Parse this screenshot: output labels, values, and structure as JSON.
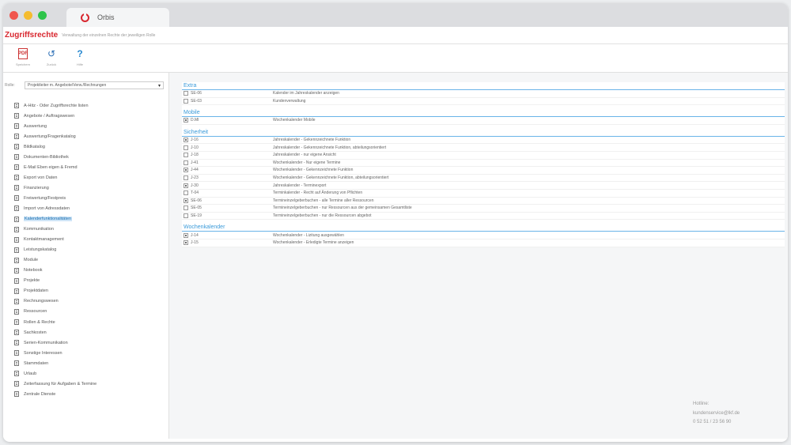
{
  "window": {
    "tab_title": "Orbis"
  },
  "header": {
    "title": "Zugriffsrechte",
    "subtitle": "Verwaltung der einzelnen Rechte der jeweiligen Rolle"
  },
  "toolbar": {
    "items": [
      {
        "label": "Speichern",
        "icon": "pdf-icon"
      },
      {
        "label": "Zurück",
        "icon": "reset-icon"
      },
      {
        "label": "Hilfe",
        "icon": "help-icon"
      }
    ]
  },
  "sidebar": {
    "select_label": "Rolle:",
    "select_value": "Projektleiter m. Angebote/Verw./Rechnungen",
    "items": [
      {
        "label": "A-Hitz - Oder Zugriffsrechte listen"
      },
      {
        "label": "Angebote / Auftragswesen"
      },
      {
        "label": "Auswertung"
      },
      {
        "label": "Auswertung/Fragenkatalog"
      },
      {
        "label": "Bildkatalog"
      },
      {
        "label": "Dokumenten-Bibliothek"
      },
      {
        "label": "E-Mail Eben eigen & Fremd"
      },
      {
        "label": "Export von Daten"
      },
      {
        "label": "Finanzierung"
      },
      {
        "label": "Freiwertung/Festpreis"
      },
      {
        "label": "Import von Adressdaten"
      },
      {
        "label": "Kalenderfunktionalitäten",
        "active": true
      },
      {
        "label": "Kommunikation"
      },
      {
        "label": "Kontaktmanagement"
      },
      {
        "label": "Leistungskatalog"
      },
      {
        "label": "Module"
      },
      {
        "label": "Notebook"
      },
      {
        "label": "Projekte"
      },
      {
        "label": "Projektdaten"
      },
      {
        "label": "Rechnungswesen"
      },
      {
        "label": "Ressourcen"
      },
      {
        "label": "Rollen & Rechte"
      },
      {
        "label": "Sachkosten"
      },
      {
        "label": "Serien-Kommunikation"
      },
      {
        "label": "Sonstige Interessen"
      },
      {
        "label": "Stammdaten"
      },
      {
        "label": "Urlaub"
      },
      {
        "label": "Zeiterfassung für Aufgaben & Termine"
      },
      {
        "label": "Zentrale Dienste"
      }
    ]
  },
  "sections": [
    {
      "title": "Extra",
      "rows": [
        {
          "code": "SE-06",
          "desc": "Kalender im Jahreskalender anzeigen",
          "checked": false
        },
        {
          "code": "SE-03",
          "desc": "Kundenverwaltung",
          "checked": false
        }
      ]
    },
    {
      "title": "Mobile",
      "rows": [
        {
          "code": "D.MI",
          "desc": "Wochenkalender Mobile",
          "checked": true
        }
      ]
    },
    {
      "title": "Sicherheit",
      "rows": [
        {
          "code": "J-16",
          "desc": "Jahreskalender - Gekennzeichnete Funktion",
          "checked": true
        },
        {
          "code": "J-10",
          "desc": "Jahreskalender - Gekennzeichnete Funktion, abteilungsorientiert",
          "checked": false
        },
        {
          "code": "J-18",
          "desc": "Jahreskalender - nur eigene Ansicht",
          "checked": false
        },
        {
          "code": "J-41",
          "desc": "Wochenkalender - Nur eigene Termine",
          "checked": false
        },
        {
          "code": "J-44",
          "desc": "Wochenkalender - Gekennzeichnete Funktion",
          "checked": true
        },
        {
          "code": "J-23",
          "desc": "Wochenkalender - Gekennzeichnete Funktion, abteilungsorientiert",
          "checked": false
        },
        {
          "code": "J-30",
          "desc": "Jahreskalender - Terminexport",
          "checked": true
        },
        {
          "code": "T-04",
          "desc": "Terminkalender - Recht auf Änderung von Pflichten",
          "checked": false
        },
        {
          "code": "SE-06",
          "desc": "Termineinzelgeberbuchen - alle Termine aller Ressourcen",
          "checked": true
        },
        {
          "code": "SE-05",
          "desc": "Termineinzelgeberbuchen - nur Ressourcen aus der gemeinsamen Gesamtliste",
          "checked": false
        },
        {
          "code": "SE-19",
          "desc": "Termineinzelgeberbuchen - nur die Ressourcen abgebot",
          "checked": false
        }
      ]
    },
    {
      "title": "Wochenkalender",
      "rows": [
        {
          "code": "J-14",
          "desc": "Wochenkalender - Lizitung ausgewählen",
          "checked": true
        },
        {
          "code": "J-15",
          "desc": "Wochenkalender - Erledigte Termine anzeigen",
          "checked": true
        }
      ]
    }
  ],
  "hotline": {
    "line1": "Hotline:",
    "line2": "kundenservice@lkf.de",
    "line3": "0 52 51 / 23 56 90"
  }
}
